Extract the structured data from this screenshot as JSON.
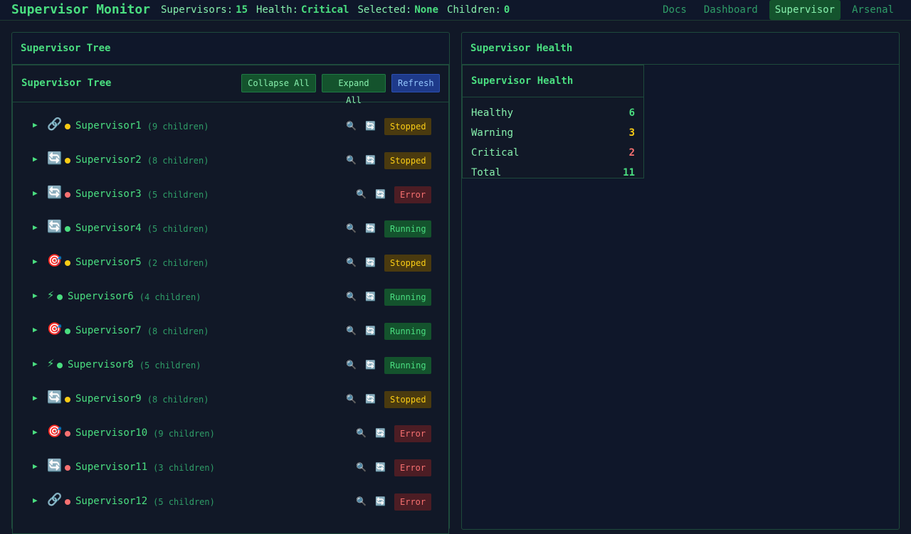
{
  "header": {
    "brand": "Supervisor Monitor",
    "stats": [
      {
        "label": "Supervisors:",
        "value": "15"
      },
      {
        "label": "Health:",
        "value": "Critical"
      },
      {
        "label": "Selected:",
        "value": "None"
      },
      {
        "label": "Children:",
        "value": "0"
      }
    ],
    "nav": [
      {
        "label": "Docs",
        "active": false
      },
      {
        "label": "Dashboard",
        "active": false
      },
      {
        "label": "Supervisor",
        "active": true
      },
      {
        "label": "Arsenal",
        "active": false
      }
    ]
  },
  "left_panel": {
    "title": "Supervisor Tree",
    "card": {
      "title": "Supervisor Tree",
      "collapse_label": "Collapse All",
      "expand_label": "Expand All",
      "refresh_label": "Refresh"
    },
    "supervisors": [
      {
        "name": "Supervisor1",
        "children": "(9 children)",
        "icon": "link-icon",
        "glyph": "🔗",
        "health": "yellow",
        "status": "Stopped"
      },
      {
        "name": "Supervisor2",
        "children": "(8 children)",
        "icon": "cycle-icon",
        "glyph": "🔄",
        "health": "yellow",
        "status": "Stopped"
      },
      {
        "name": "Supervisor3",
        "children": "(5 children)",
        "icon": "cycle-icon",
        "glyph": "🔄",
        "health": "red",
        "status": "Error"
      },
      {
        "name": "Supervisor4",
        "children": "(5 children)",
        "icon": "cycle-icon",
        "glyph": "🔄",
        "health": "green",
        "status": "Running"
      },
      {
        "name": "Supervisor5",
        "children": "(2 children)",
        "icon": "target-icon",
        "glyph": "🎯",
        "health": "yellow",
        "status": "Stopped"
      },
      {
        "name": "Supervisor6",
        "children": "(4 children)",
        "icon": "lightning-icon",
        "glyph": "⚡",
        "health": "green",
        "status": "Running"
      },
      {
        "name": "Supervisor7",
        "children": "(8 children)",
        "icon": "target-icon",
        "glyph": "🎯",
        "health": "green",
        "status": "Running"
      },
      {
        "name": "Supervisor8",
        "children": "(5 children)",
        "icon": "lightning-icon",
        "glyph": "⚡",
        "health": "green",
        "status": "Running"
      },
      {
        "name": "Supervisor9",
        "children": "(8 children)",
        "icon": "cycle-icon",
        "glyph": "🔄",
        "health": "yellow",
        "status": "Stopped"
      },
      {
        "name": "Supervisor10",
        "children": "(9 children)",
        "icon": "target-icon",
        "glyph": "🎯",
        "health": "red",
        "status": "Error"
      },
      {
        "name": "Supervisor11",
        "children": "(3 children)",
        "icon": "cycle-icon",
        "glyph": "🔄",
        "health": "red",
        "status": "Error"
      },
      {
        "name": "Supervisor12",
        "children": "(5 children)",
        "icon": "link-icon",
        "glyph": "🔗",
        "health": "red",
        "status": "Error"
      }
    ],
    "row_actions": {
      "inspect_glyph": "🔍",
      "restart_glyph": "🔄"
    }
  },
  "right_panel": {
    "title": "Supervisor Health",
    "card": {
      "title": "Supervisor Health",
      "rows": [
        {
          "label": "Healthy",
          "value": "6",
          "color": "#4ade80"
        },
        {
          "label": "Warning",
          "value": "3",
          "color": "#facc15"
        },
        {
          "label": "Critical",
          "value": "2",
          "color": "#f87171"
        },
        {
          "label": "Total",
          "value": "11",
          "color": "#4ade80"
        }
      ]
    }
  },
  "colors": {
    "accent": "#4ade80",
    "background": "#111827",
    "warning": "#facc15",
    "error": "#f87171",
    "info": "#60a5fa"
  }
}
